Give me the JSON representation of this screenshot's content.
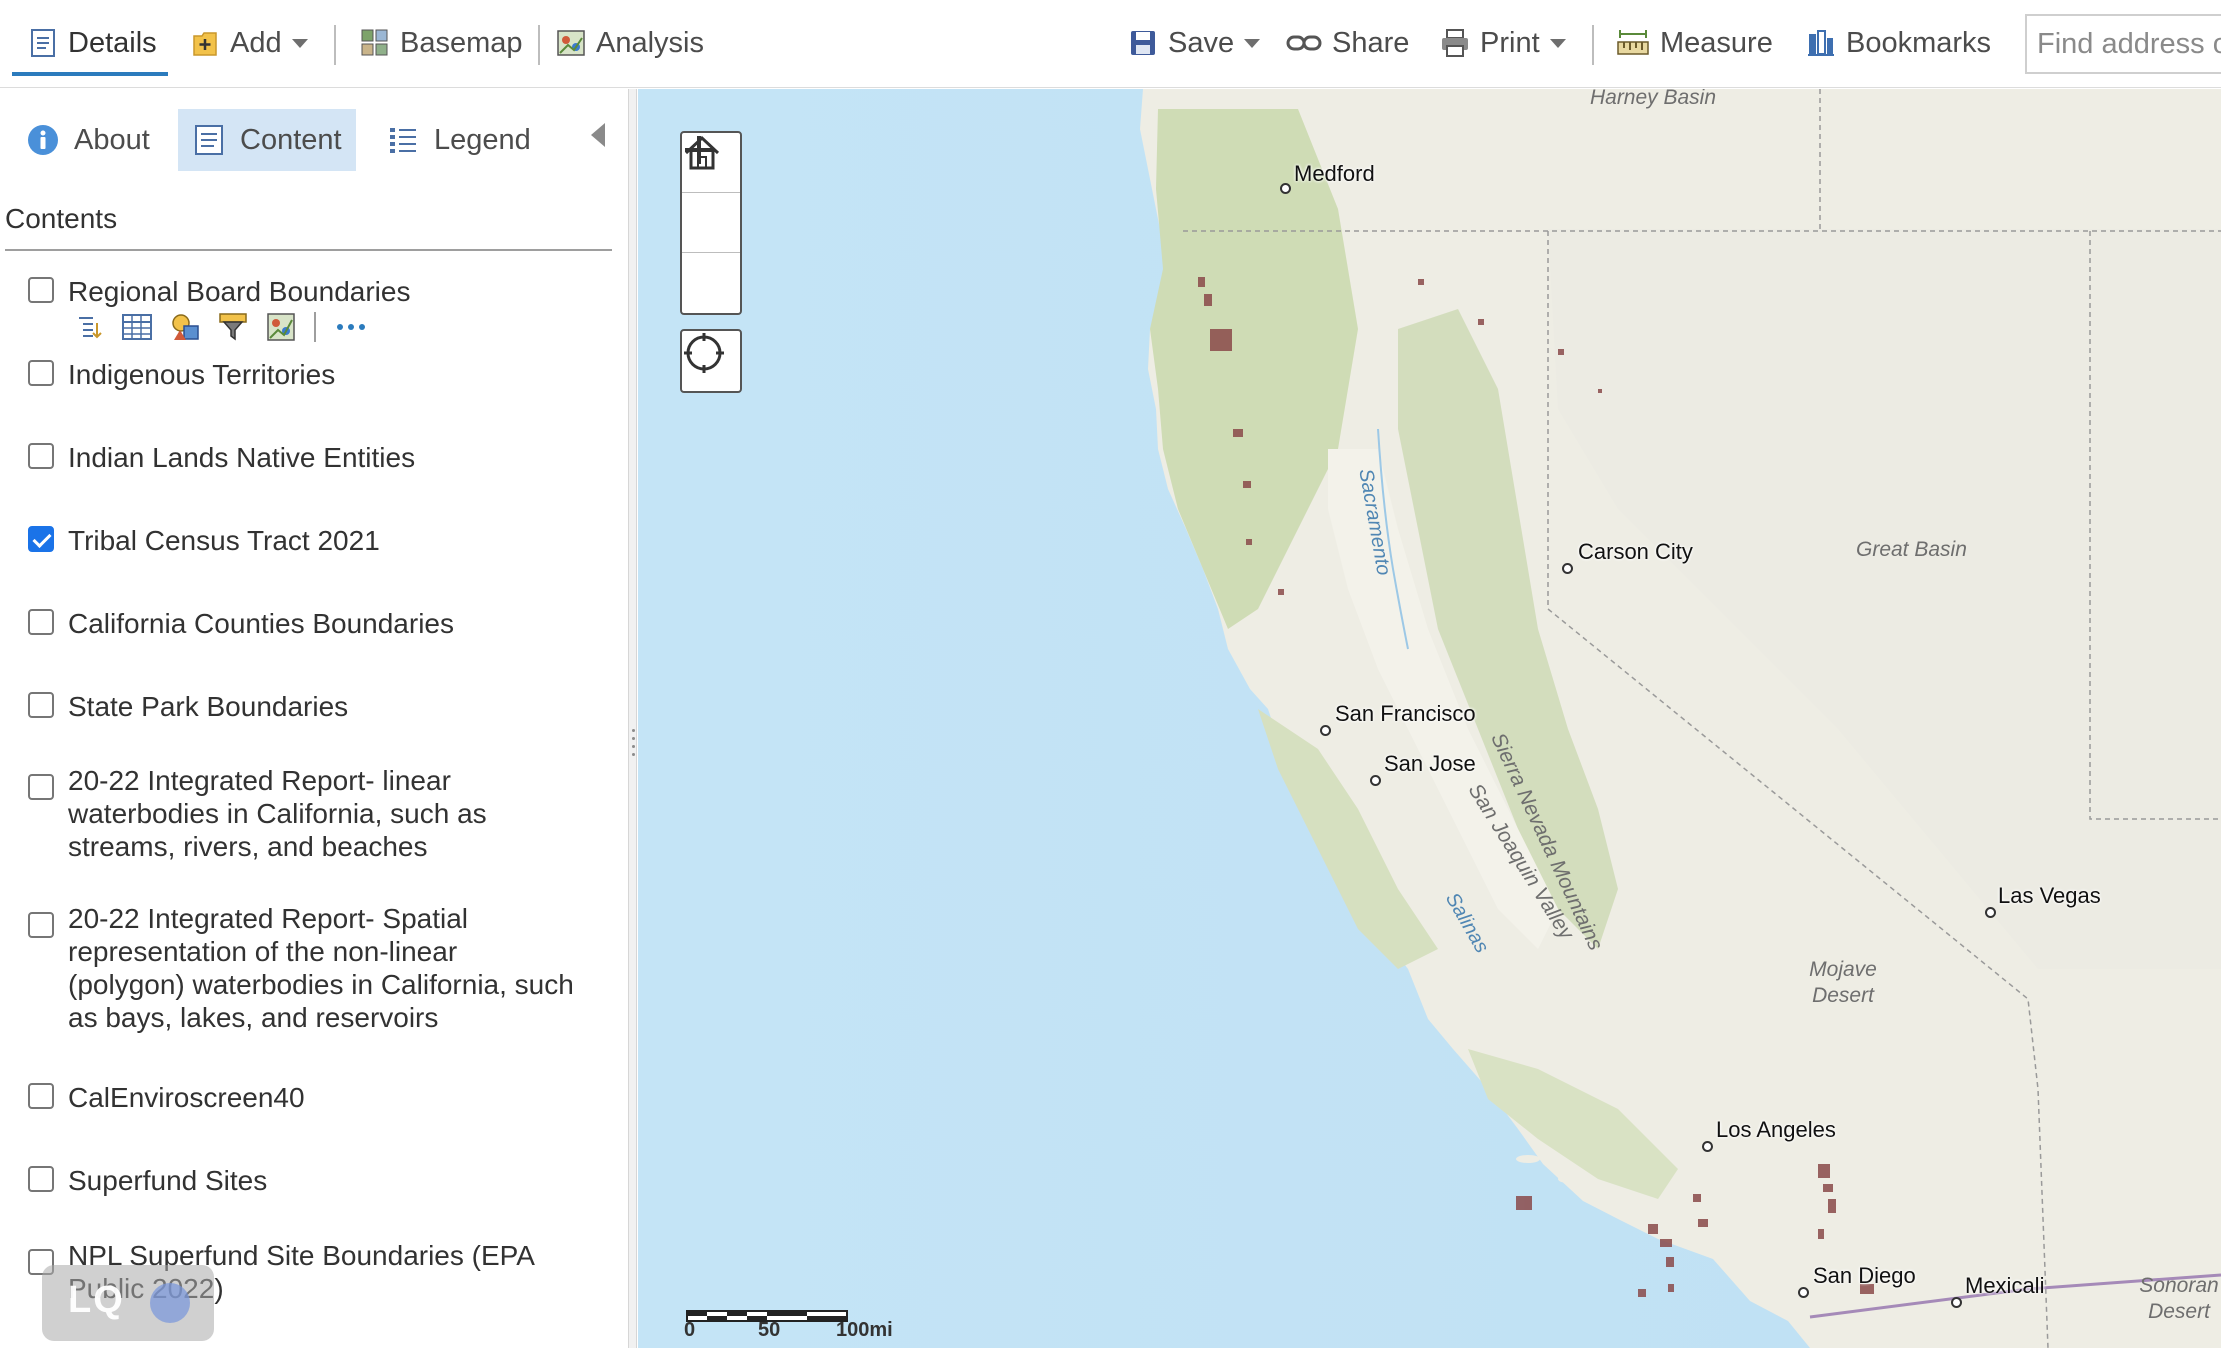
{
  "toolbar": {
    "details": "Details",
    "add": "Add",
    "basemap": "Basemap",
    "analysis": "Analysis",
    "save": "Save",
    "share": "Share",
    "print": "Print",
    "measure": "Measure",
    "bookmarks": "Bookmarks",
    "search_placeholder": "Find address o"
  },
  "panel": {
    "tabs": {
      "about": "About",
      "content": "Content",
      "legend": "Legend"
    },
    "contents_title": "Contents",
    "layers": [
      {
        "label": "Regional Board Boundaries",
        "checked": false
      },
      {
        "label": "Indigenous Territories",
        "checked": false
      },
      {
        "label": "Indian Lands Native Entities",
        "checked": false
      },
      {
        "label": "Tribal Census Tract 2021",
        "checked": true
      },
      {
        "label": "California Counties Boundaries",
        "checked": false
      },
      {
        "label": "State Park Boundaries",
        "checked": false
      },
      {
        "label": "20-22 Integrated Report- linear waterbodies in California, such as streams, rivers, and beaches",
        "checked": false
      },
      {
        "label": "20-22 Integrated Report- Spatial representation of the non-linear (polygon) waterbodies in California, such as bays, lakes, and reservoirs",
        "checked": false
      },
      {
        "label": "CalEnviroscreen40",
        "checked": false
      },
      {
        "label": "Superfund Sites",
        "checked": false
      },
      {
        "label": "NPL Superfund Site Boundaries (EPA Public 2022)",
        "checked": false
      }
    ],
    "watermark": "LQ"
  },
  "map": {
    "cities": [
      "Medford",
      "Carson City",
      "San Francisco",
      "San Jose",
      "Las Vegas",
      "Los Angeles",
      "San Diego",
      "Mexicali"
    ],
    "regions": {
      "harney_basin": "Harney Basin",
      "great_basin": "Great Basin",
      "sierra_nevada": "Sierra Nevada Mountains",
      "san_joaquin": "San Joaquin Valley",
      "mojave": "Mojave Desert",
      "sonoran": "Sonoran Desert"
    },
    "water": {
      "sacramento": "Sacramento",
      "salinas": "Salinas"
    },
    "scale": {
      "l0": "0",
      "l1": "50",
      "l2": "100mi"
    },
    "colors": {
      "ocean": "#c8e6f5",
      "land": "#eeeee6",
      "forest": "#cfdcb8",
      "tracts": "#8a4a4a"
    }
  }
}
